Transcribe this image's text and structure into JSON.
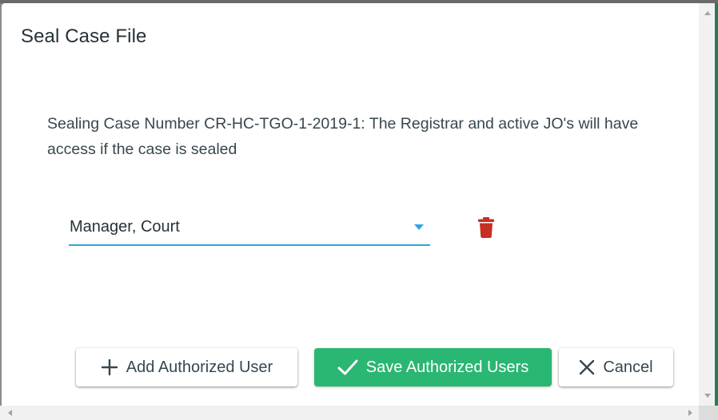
{
  "dialog": {
    "title": "Seal Case File",
    "message": "Sealing Case Number CR-HC-TGO-1-2019-1: The Registrar and active JO's will have access if the case is sealed"
  },
  "authorized_users": [
    {
      "selected_value": "Manager, Court",
      "dropdown_icon": "caret-down-icon",
      "delete_icon": "trash-icon"
    }
  ],
  "buttons": {
    "add_label": "Add Authorized User",
    "add_icon": "plus-icon",
    "save_label": "Save Authorized Users",
    "save_icon": "check-icon",
    "cancel_label": "Cancel",
    "cancel_icon": "close-icon"
  },
  "colors": {
    "accent": "#29a8e0",
    "save_green": "#2ab673",
    "delete_red": "#c62f22",
    "text_dark": "#263238"
  }
}
